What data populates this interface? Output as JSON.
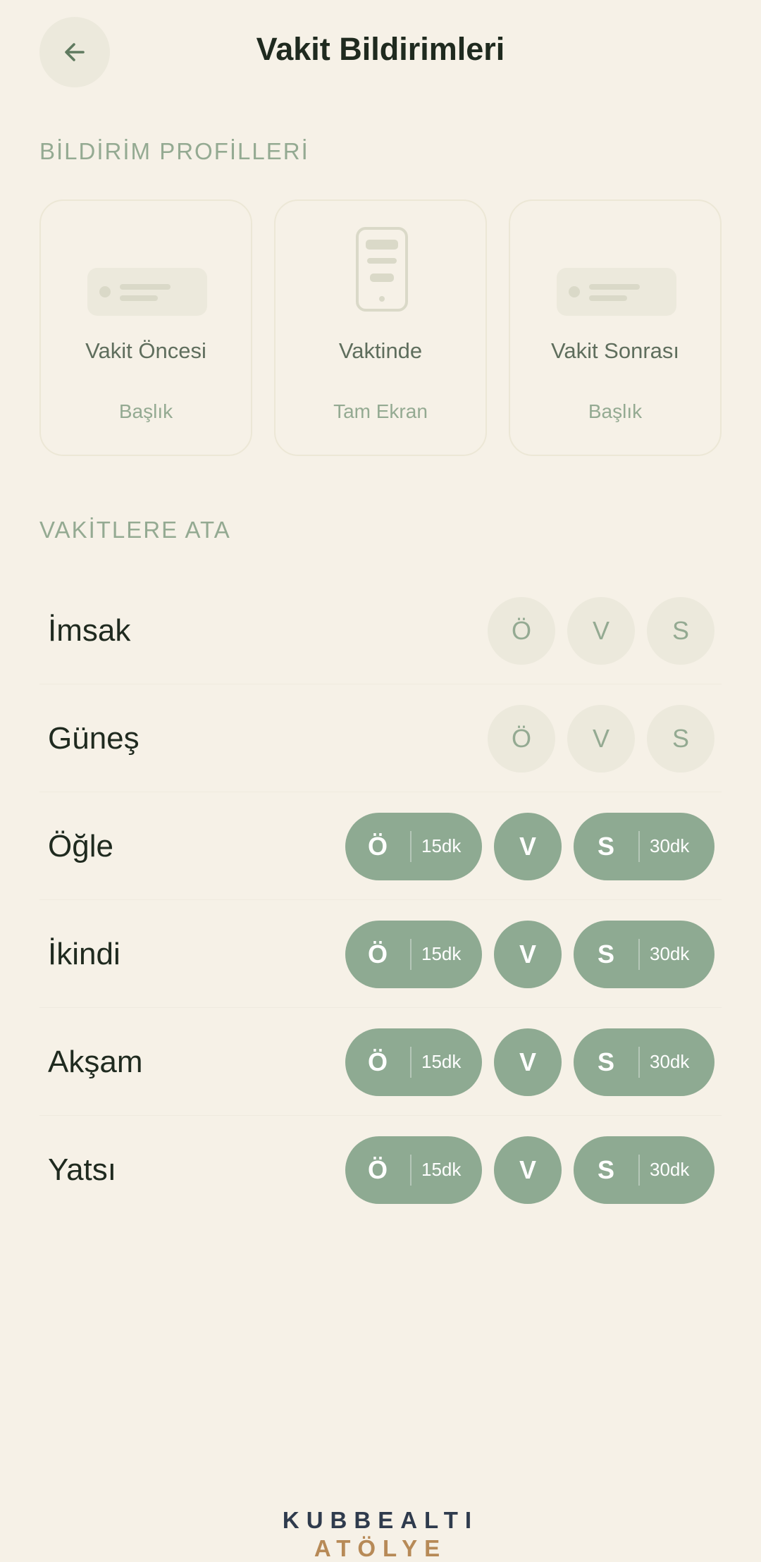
{
  "header": {
    "title": "Vakit Bildirimleri",
    "back_icon": "arrow-left-icon"
  },
  "profiles": {
    "section_label": "BİLDİRİM PROFİLLERİ",
    "cards": [
      {
        "title": "Vakit Öncesi",
        "subtitle": "Başlık",
        "preview_icon": "banner-notification-icon"
      },
      {
        "title": "Vaktinde",
        "subtitle": "Tam Ekran",
        "preview_icon": "phone-fullscreen-icon"
      },
      {
        "title": "Vakit Sonrası",
        "subtitle": "Başlık",
        "preview_icon": "banner-notification-icon"
      }
    ]
  },
  "assign": {
    "section_label": "VAKİTLERE ATA",
    "rows": [
      {
        "name": "İmsak",
        "o": "Ö",
        "v": "V",
        "s": "S",
        "active": false
      },
      {
        "name": "Güneş",
        "o": "Ö",
        "v": "V",
        "s": "S",
        "active": false
      },
      {
        "name": "Öğle",
        "o": "Ö",
        "o_min": "15dk",
        "v": "V",
        "s": "S",
        "s_min": "30dk",
        "active": true
      },
      {
        "name": "İkindi",
        "o": "Ö",
        "o_min": "15dk",
        "v": "V",
        "s": "S",
        "s_min": "30dk",
        "active": true
      },
      {
        "name": "Akşam",
        "o": "Ö",
        "o_min": "15dk",
        "v": "V",
        "s": "S",
        "s_min": "30dk",
        "active": true
      },
      {
        "name": "Yatsı",
        "o": "Ö",
        "o_min": "15dk",
        "v": "V",
        "s": "S",
        "s_min": "30dk",
        "active": true
      }
    ]
  },
  "footer": {
    "line1": "KUBBEALTI",
    "line2": "ATÖLYE"
  },
  "colors": {
    "background": "#F6F1E7",
    "accent": "#8EAA92",
    "muted": "#94AA92",
    "chip_off": "#ECE9DC",
    "brand_gold": "#B78A57"
  }
}
